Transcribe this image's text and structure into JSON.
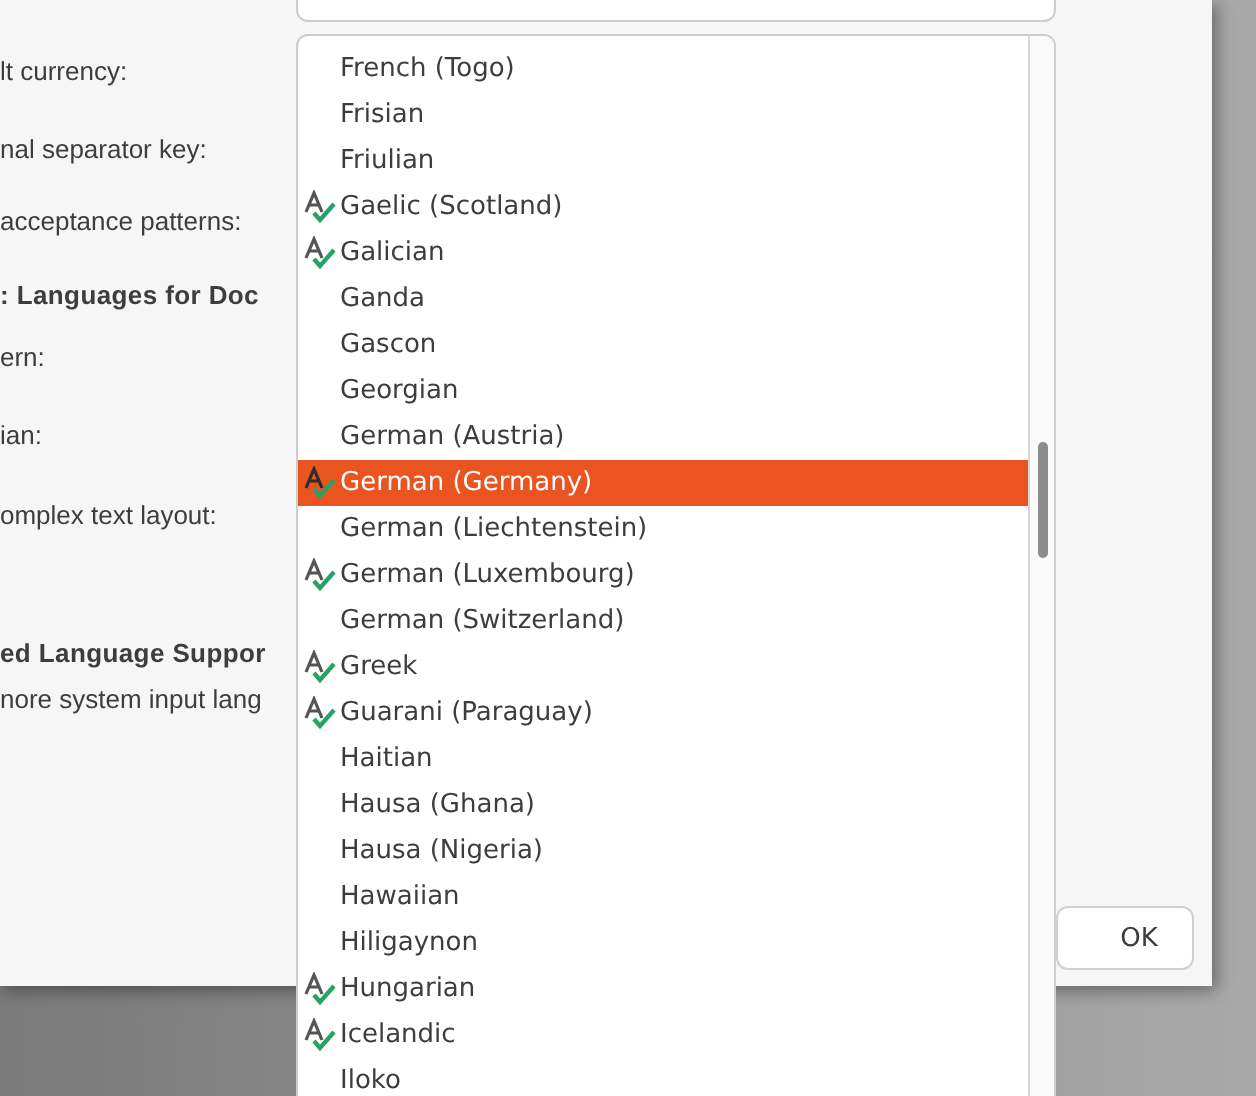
{
  "form": {
    "labels": [
      {
        "text": "lt currency:",
        "kind": "label"
      },
      {
        "text": "nal separator key:",
        "kind": "label"
      },
      {
        "text": "acceptance patterns:",
        "kind": "label"
      },
      {
        "text": ": Languages for Doc",
        "kind": "heading"
      },
      {
        "text": "ern:",
        "kind": "label"
      },
      {
        "text": "ian:",
        "kind": "label"
      },
      {
        "text": "omplex text layout:",
        "kind": "label"
      },
      {
        "text": "ed Language Suppor",
        "kind": "heading"
      },
      {
        "text": "nore system input lang",
        "kind": "label"
      }
    ],
    "ok_button": "OK"
  },
  "language_list": {
    "items": [
      {
        "label": "French (Togo)",
        "spellcheck": false,
        "selected": false
      },
      {
        "label": "Frisian",
        "spellcheck": false,
        "selected": false
      },
      {
        "label": "Friulian",
        "spellcheck": false,
        "selected": false
      },
      {
        "label": "Gaelic (Scotland)",
        "spellcheck": true,
        "selected": false
      },
      {
        "label": "Galician",
        "spellcheck": true,
        "selected": false
      },
      {
        "label": "Ganda",
        "spellcheck": false,
        "selected": false
      },
      {
        "label": "Gascon",
        "spellcheck": false,
        "selected": false
      },
      {
        "label": "Georgian",
        "spellcheck": false,
        "selected": false
      },
      {
        "label": "German (Austria)",
        "spellcheck": false,
        "selected": false
      },
      {
        "label": "German (Germany)",
        "spellcheck": true,
        "selected": true
      },
      {
        "label": "German (Liechtenstein)",
        "spellcheck": false,
        "selected": false
      },
      {
        "label": "German (Luxembourg)",
        "spellcheck": true,
        "selected": false
      },
      {
        "label": "German (Switzerland)",
        "spellcheck": false,
        "selected": false
      },
      {
        "label": "Greek",
        "spellcheck": true,
        "selected": false
      },
      {
        "label": "Guarani (Paraguay)",
        "spellcheck": true,
        "selected": false
      },
      {
        "label": "Haitian",
        "spellcheck": false,
        "selected": false
      },
      {
        "label": "Hausa (Ghana)",
        "spellcheck": false,
        "selected": false
      },
      {
        "label": "Hausa (Nigeria)",
        "spellcheck": false,
        "selected": false
      },
      {
        "label": "Hawaiian",
        "spellcheck": false,
        "selected": false
      },
      {
        "label": "Hiligaynon",
        "spellcheck": false,
        "selected": false
      },
      {
        "label": "Hungarian",
        "spellcheck": true,
        "selected": false
      },
      {
        "label": "Icelandic",
        "spellcheck": true,
        "selected": false
      },
      {
        "label": "Iloko",
        "spellcheck": false,
        "selected": false
      }
    ]
  }
}
